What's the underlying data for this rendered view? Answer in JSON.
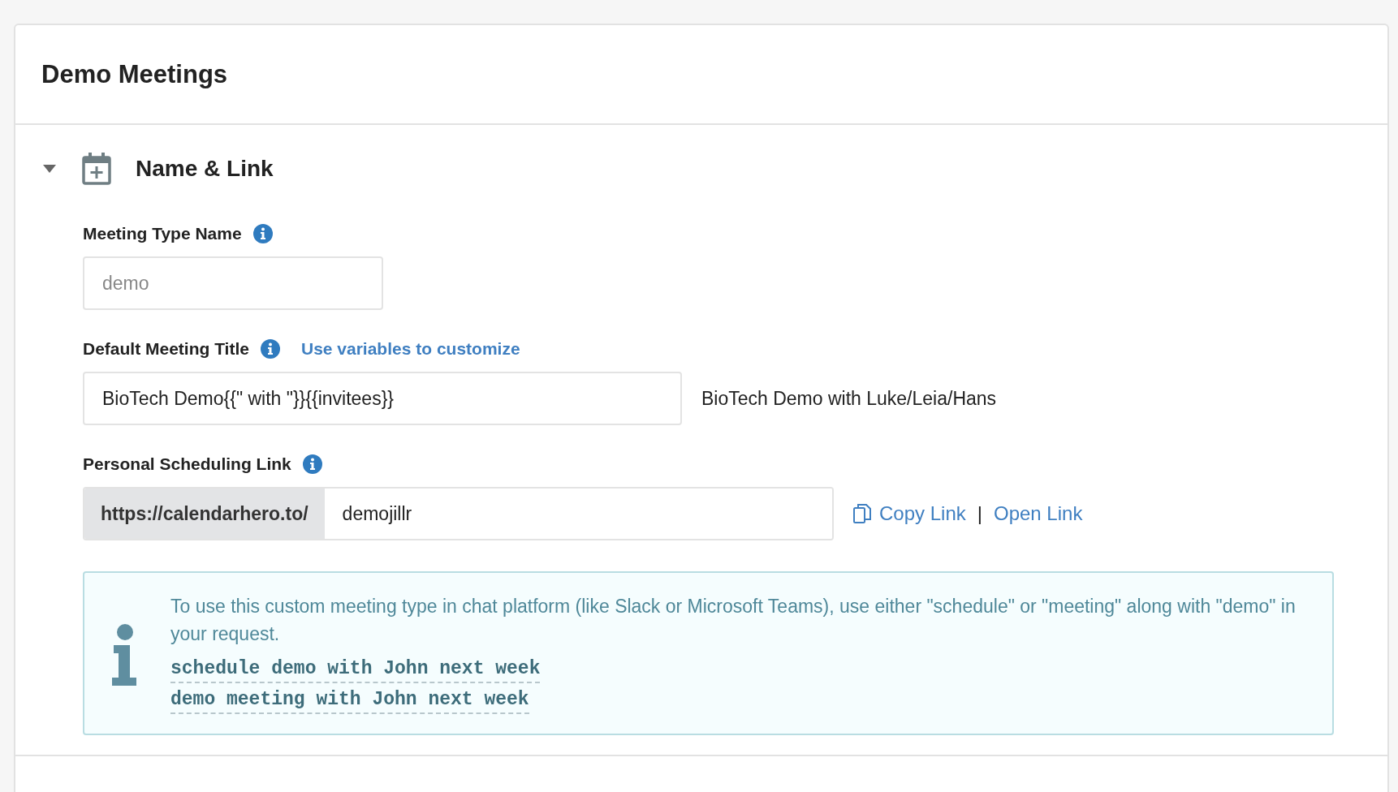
{
  "page": {
    "title": "Demo Meetings"
  },
  "section": {
    "title": "Name & Link",
    "expanded": true,
    "fields": [
      {
        "kind": "text",
        "label": "Meeting Type Name",
        "value": "demo",
        "disabled": true
      },
      {
        "kind": "template",
        "label": "Default Meeting Title",
        "link": "Use variables to customize",
        "value": "BioTech Demo{{\" with \"}}{{invitees}}",
        "preview": "BioTech Demo with Luke/Leia/Hans",
        "disabled": false
      },
      {
        "kind": "link",
        "label": "Personal Scheduling Link",
        "prefix": "https://calendarhero.to/",
        "value": "demojillr",
        "disabled": false,
        "copy_action": "Copy Link",
        "separator": "|",
        "open_action": "Open Link"
      }
    ],
    "note": {
      "text": "To use this custom meeting type in chat platform (like Slack or Microsoft Teams), use either \"schedule\" or \"meeting\" along with \"demo\" in your request.",
      "examples": [
        "schedule demo with John next week",
        "demo meeting with John next week"
      ]
    }
  }
}
